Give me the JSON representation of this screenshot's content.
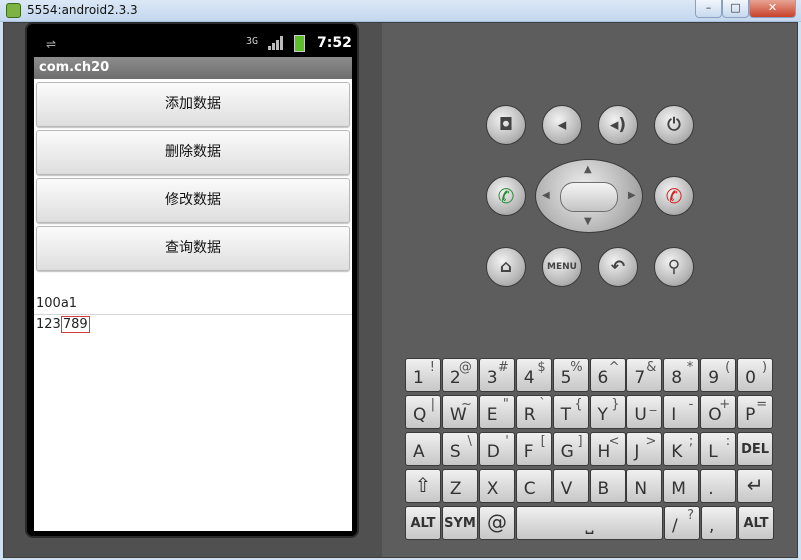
{
  "window": {
    "title": "5554:android2.3.3",
    "min": "–",
    "max": "□",
    "close": "✕"
  },
  "statusbar": {
    "usb_icon": "usb-icon",
    "network": "3G",
    "time": "7:52"
  },
  "app": {
    "title": "com.ch20",
    "buttons": [
      "添加数据",
      "删除数据",
      "修改数据",
      "查询数据"
    ],
    "result_text": "100a1",
    "edit_prefix": "123",
    "edit_selected": "789"
  },
  "hardware": {
    "camera": "◘",
    "vol_down": "◂",
    "vol_up": "◂)",
    "power": "⏻",
    "call": "✆",
    "end": "✆",
    "home": "⌂",
    "menu": "MENU",
    "back": "↶",
    "search": "⚲",
    "dpad_up": "▲",
    "dpad_down": "▼",
    "dpad_left": "◀",
    "dpad_right": "▶"
  },
  "keyboard": {
    "row1": [
      {
        "main": "1",
        "alt": "!"
      },
      {
        "main": "2",
        "alt": "@"
      },
      {
        "main": "3",
        "alt": "#"
      },
      {
        "main": "4",
        "alt": "$"
      },
      {
        "main": "5",
        "alt": "%"
      },
      {
        "main": "6",
        "alt": "^"
      },
      {
        "main": "7",
        "alt": "&"
      },
      {
        "main": "8",
        "alt": "*"
      },
      {
        "main": "9",
        "alt": "("
      },
      {
        "main": "0",
        "alt": ")"
      }
    ],
    "row2": [
      {
        "main": "Q",
        "alt": "|"
      },
      {
        "main": "W",
        "alt": "~"
      },
      {
        "main": "E",
        "alt": "\""
      },
      {
        "main": "R",
        "alt": "`"
      },
      {
        "main": "T",
        "alt": "{"
      },
      {
        "main": "Y",
        "alt": "}"
      },
      {
        "main": "U",
        "alt": "_"
      },
      {
        "main": "I",
        "alt": "-"
      },
      {
        "main": "O",
        "alt": "+"
      },
      {
        "main": "P",
        "alt": "="
      }
    ],
    "row3": [
      {
        "main": "A",
        "alt": ""
      },
      {
        "main": "S",
        "alt": "\\"
      },
      {
        "main": "D",
        "alt": "'"
      },
      {
        "main": "F",
        "alt": "["
      },
      {
        "main": "G",
        "alt": "]"
      },
      {
        "main": "H",
        "alt": "<"
      },
      {
        "main": "J",
        "alt": ">"
      },
      {
        "main": "K",
        "alt": ";"
      },
      {
        "main": "L",
        "alt": ":"
      },
      {
        "main": "DEL",
        "alt": ""
      }
    ],
    "row4": [
      {
        "main": "⇧",
        "alt": ""
      },
      {
        "main": "Z",
        "alt": ""
      },
      {
        "main": "X",
        "alt": ""
      },
      {
        "main": "C",
        "alt": ""
      },
      {
        "main": "V",
        "alt": ""
      },
      {
        "main": "B",
        "alt": ""
      },
      {
        "main": "N",
        "alt": ""
      },
      {
        "main": "M",
        "alt": ""
      },
      {
        "main": ".",
        "alt": ""
      },
      {
        "main": "↵",
        "alt": ""
      }
    ],
    "row5": {
      "alt_left": "ALT",
      "sym": "SYM",
      "at": "@",
      "space": "⎵",
      "slash": "/",
      "question": "?",
      "comma": ",",
      "alt_right": "ALT"
    }
  }
}
